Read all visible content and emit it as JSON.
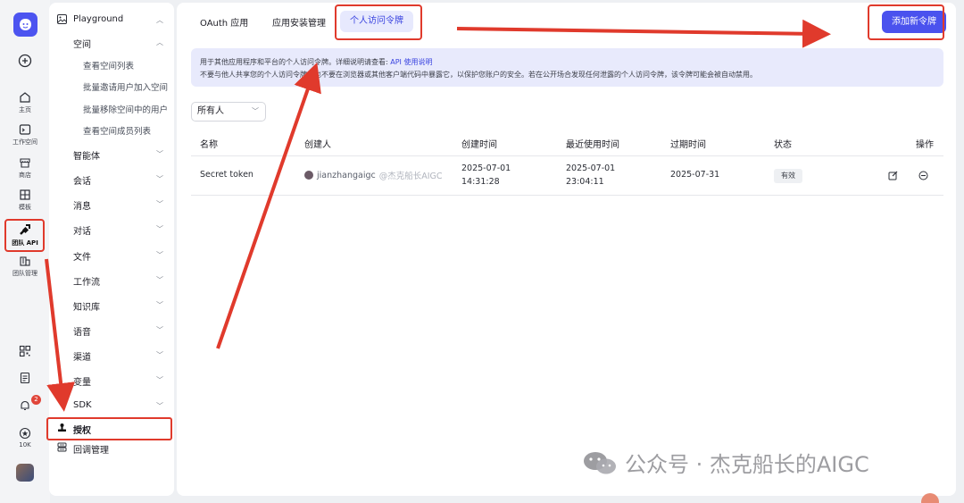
{
  "rail": {
    "items": [
      {
        "label": "主页",
        "icon": "home-icon"
      },
      {
        "label": "工作空间",
        "icon": "terminal-icon"
      },
      {
        "label": "商店",
        "icon": "store-icon"
      },
      {
        "label": "模板",
        "icon": "template-icon"
      },
      {
        "label": "团队 API",
        "icon": "api-icon"
      },
      {
        "label": "团队管理",
        "icon": "building-icon"
      }
    ],
    "bottom": {
      "notifications_badge": "2",
      "stars_count": "10K"
    }
  },
  "sidebar": {
    "title": "Playground",
    "space": {
      "label": "空间",
      "items": [
        "查看空间列表",
        "批量邀请用户加入空间",
        "批量移除空间中的用户",
        "查看空间成员列表"
      ]
    },
    "sections": [
      "智能体",
      "会话",
      "消息",
      "对话",
      "文件",
      "工作流",
      "知识库",
      "语音",
      "渠道",
      "变量",
      "SDK"
    ],
    "auth": "授权",
    "callback": "回调管理"
  },
  "tabs": [
    "OAuth 应用",
    "应用安装管理",
    "个人访问令牌"
  ],
  "add_button": "添加新令牌",
  "info": {
    "line1": "用于其他应用程序和平台的个人访问令牌。详细说明请查看:",
    "link": "API 使用说明",
    "line2": "不要与他人共享您的个人访问令牌，也不要在浏览器或其他客户端代码中暴露它，以保护您账户的安全。若在公开场合发现任何泄露的个人访问令牌，该令牌可能会被自动禁用。"
  },
  "filter": {
    "selected": "所有人"
  },
  "table": {
    "headers": [
      "名称",
      "创建人",
      "创建时间",
      "最近使用时间",
      "过期时间",
      "状态",
      "操作"
    ],
    "rows": [
      {
        "name": "Secret token",
        "creator": "jianzhangaigc",
        "creator_sub": "@杰克船长AIGC",
        "created_date": "2025-07-01",
        "created_time": "14:31:28",
        "last_used_date": "2025-07-01",
        "last_used_time": "23:04:11",
        "expires": "2025-07-31",
        "status": "有效"
      }
    ]
  },
  "watermark": "公众号 · 杰克船长的AIGC",
  "colors": {
    "accent": "#4a52ee",
    "highlight": "#e03a2c"
  }
}
